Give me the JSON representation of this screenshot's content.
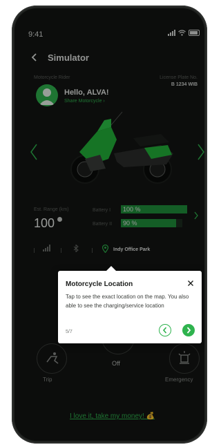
{
  "status_bar": {
    "time": "9:41"
  },
  "header": {
    "title": "Simulator"
  },
  "rider": {
    "label": "Motorcycle Rider",
    "greeting": "Hello, ALVA!",
    "share_link": "Share Motorcycle"
  },
  "plate": {
    "label": "License Plate No.",
    "value": "B 1234 WIB"
  },
  "range": {
    "label": "Est. Range (km)",
    "value": "100"
  },
  "batteries": [
    {
      "label": "Battery I",
      "text": "100 %",
      "level": 1.0
    },
    {
      "label": "Battery II",
      "text": "90 %",
      "level": 0.9
    }
  ],
  "connectivity": {
    "location": "Indy Office Park"
  },
  "controls": {
    "trip_label": "Trip",
    "power_label": "Off",
    "emergency_label": "Emergency"
  },
  "cta": {
    "label": "I love it, take my money! 💰"
  },
  "tooltip": {
    "title": "Motorcycle Location",
    "body": "Tap to see the exact location on the map. You also able to see the charging/service location",
    "step": "5/7",
    "close_icon": "close-icon",
    "prev_icon": "chevron-left-icon",
    "next_icon": "chevron-right-icon"
  },
  "colors": {
    "accent": "#2fb34e",
    "background": "#131513",
    "bar_fill": "#1f8f3b"
  }
}
